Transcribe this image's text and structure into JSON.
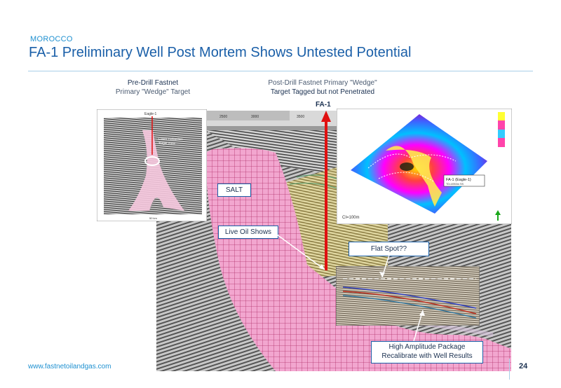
{
  "header": {
    "country": "MOROCCO",
    "title": "FA-1 Preliminary Well Post Mortem Shows Untested Potential"
  },
  "captions": {
    "left": {
      "line1": "Pre-Drill Fastnet",
      "line2": "Primary \"Wedge\" Target"
    },
    "right": {
      "line1": "Post-Drill Fastnet Primary \"Wedge\"",
      "line2": "Target Tagged but not Penetrated"
    }
  },
  "well_label": "FA-1",
  "callouts": {
    "salt": "SALT",
    "oil": "Live Oil Shows",
    "flat": "Flat Spot??",
    "amp_line1": "High Amplitude Package",
    "amp_line2": "Recalibrate with Well Results"
  },
  "inset_left": {
    "well": "Eagle-1",
    "zone_line1": "Lower Turbanites",
    "zone_line2": "Target Zone",
    "scale": "50 km"
  },
  "inset_map": {
    "well": "FA-1 (Eagle-1)",
    "td": "TD=4953m SS",
    "ci": "CI=100m"
  },
  "footer": {
    "url": "www.fastnetoilandgas.com",
    "page": "24"
  },
  "colors": {
    "accent": "#1a5fa8",
    "salt": "#f2a6cf",
    "well": "#e01010"
  }
}
